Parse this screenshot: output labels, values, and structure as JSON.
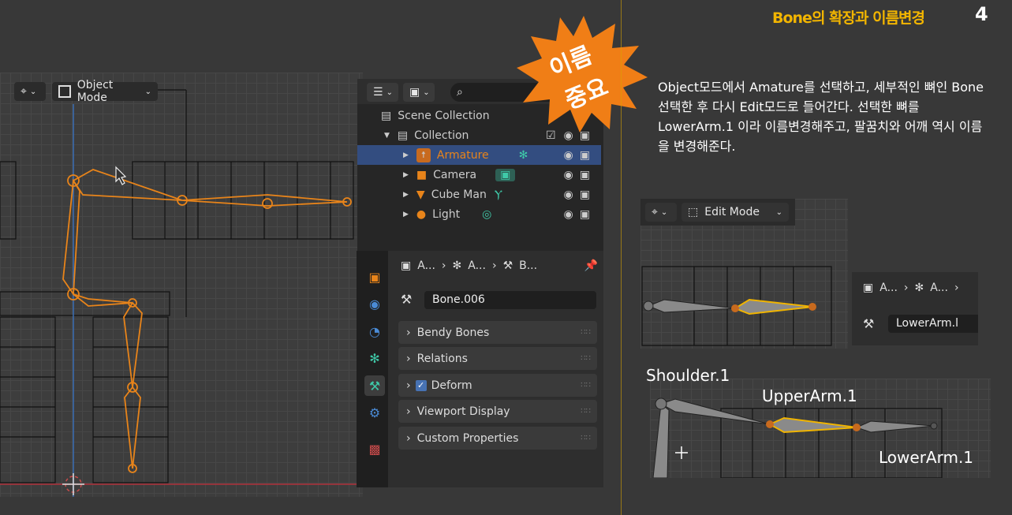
{
  "page": {
    "title": "Bone의 확장과 이름변경",
    "page_number": "4"
  },
  "badge": {
    "line1": "이름",
    "line2": "중요",
    "color": "#f07e16"
  },
  "viewport_left": {
    "mode_label": "Object Mode"
  },
  "outliner": {
    "scene_collection": "Scene Collection",
    "collection": "Collection",
    "items": [
      {
        "label": "Armature",
        "icon": "armature-icon",
        "selected": true
      },
      {
        "label": "Camera",
        "icon": "camera-icon"
      },
      {
        "label": "Cube Man",
        "icon": "mesh-icon"
      },
      {
        "label": "Light",
        "icon": "light-icon"
      }
    ]
  },
  "properties": {
    "breadcrumb": [
      "A...",
      "A...",
      "B..."
    ],
    "bone_name": "Bone.006",
    "panels": [
      "Bendy Bones",
      "Relations",
      "Deform",
      "Viewport Display",
      "Custom Properties"
    ]
  },
  "description": "Object모드에서 Amature를 선택하고, 세부적인 뼈인 Bone선택한 후 다시 Edit모드로 들어간다. 선택한 뼈를 LowerArm.1 이라 이름변경해주고, 팔꿈치와 어깨 역시 이름을 변경해준다.",
  "viewport_right": {
    "mode_label": "Edit Mode",
    "breadcrumb": [
      "A...",
      "A..."
    ],
    "bone_name": "LowerArm.l"
  },
  "bone_labels": {
    "shoulder": "Shoulder.1",
    "upper": "UpperArm.1",
    "lower": "LowerArm.1"
  },
  "colors": {
    "accent_yellow": "#f2b500",
    "selection_blue": "#334d80",
    "bone_orange": "#e8841a"
  }
}
